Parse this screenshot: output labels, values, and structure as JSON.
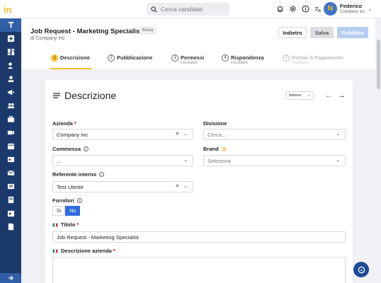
{
  "search": {
    "placeholder": "Cerca candidati"
  },
  "user": {
    "name": "Federico",
    "company": "Company Inc",
    "avatar_letter": "N"
  },
  "header": {
    "title": "Job Request - Marketing Specialist",
    "badge": "Bozza",
    "subtitle": "di Company Inc",
    "buttons": {
      "back": "Indietro",
      "save": "Salva",
      "publish": "Pubblica"
    }
  },
  "steps": [
    {
      "num": "1",
      "label": "Descrizione",
      "sub": ""
    },
    {
      "num": "2",
      "label": "Pubblicazione",
      "sub": ""
    },
    {
      "num": "3",
      "label": "Permessi",
      "sub": "Facoltativo"
    },
    {
      "num": "4",
      "label": "Rispondenza",
      "sub": "Facoltativo"
    },
    {
      "num": "5",
      "label": "Portali A Pagamento",
      "sub": "Facoltativo"
    }
  ],
  "card": {
    "title": "Descrizione",
    "language": "Italiano",
    "fields": {
      "azienda": {
        "label": "Azienda",
        "required": "*",
        "value": "Company Inc",
        "ctrl": "✕ ⌄"
      },
      "divisione": {
        "label": "Divisione",
        "placeholder": "Cerca...",
        "ctrl": "⌄"
      },
      "commessa": {
        "label": "Commessa",
        "value": "...",
        "ctrl": "⌄"
      },
      "brand": {
        "label": "Brand",
        "placeholder": "Seleziona",
        "ctrl": "⌄"
      },
      "referente": {
        "label": "Referente interno",
        "value": "Test Utente",
        "ctrl": "✕ ⌄"
      },
      "fornitori": {
        "label": "Fornitori",
        "options": [
          "Si",
          "No"
        ],
        "selected": "No"
      },
      "titolo": {
        "label": "Titolo",
        "required": "*",
        "value": "Job Request - Marketing Specialist"
      },
      "descrizione_azienda": {
        "label": "Descrizione azienda",
        "required": "*"
      }
    }
  },
  "colors": {
    "sidebar": "#1b3a6b",
    "accent": "#f7c32e",
    "primary": "#2f6ee0"
  }
}
